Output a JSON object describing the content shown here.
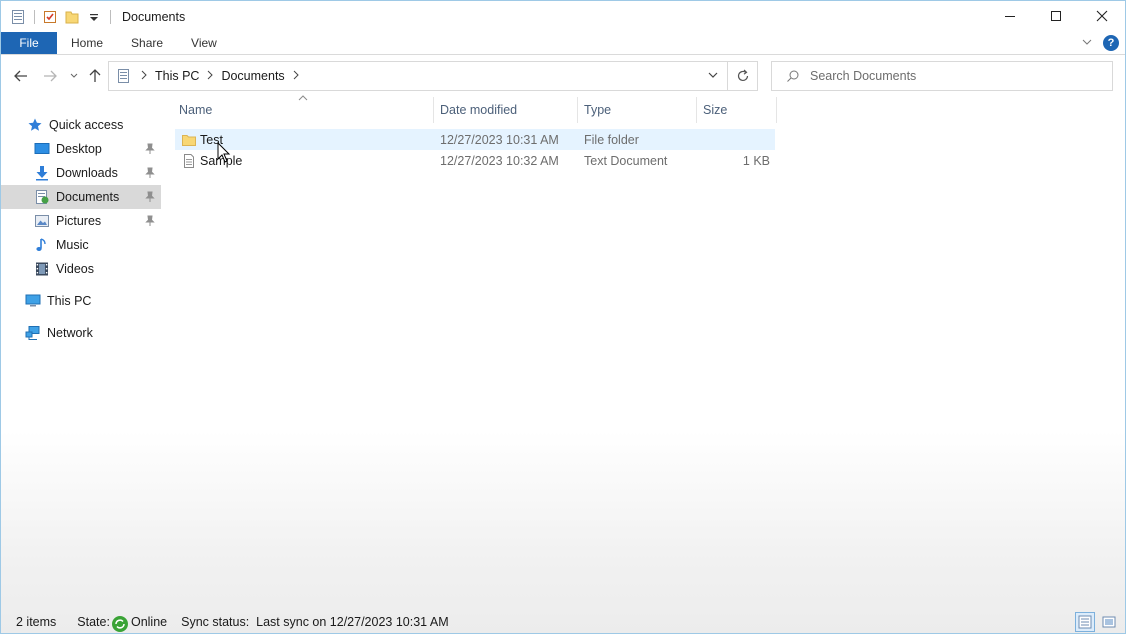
{
  "window": {
    "title": "Documents",
    "controls": {
      "minimize": "—",
      "maximize": "☐",
      "close": "✕"
    }
  },
  "ribbon": {
    "tabs": [
      "File",
      "Home",
      "Share",
      "View"
    ],
    "help": "?"
  },
  "nav": {
    "breadcrumb": [
      "This PC",
      "Documents"
    ],
    "search_placeholder": "Search Documents"
  },
  "sidebar": {
    "items": [
      {
        "label": "Quick access",
        "icon": "star-icon",
        "pinned": false,
        "selected": false
      },
      {
        "label": "Desktop",
        "icon": "desktop-folder-icon",
        "pinned": true,
        "selected": false
      },
      {
        "label": "Downloads",
        "icon": "download-arrow-icon",
        "pinned": true,
        "selected": false
      },
      {
        "label": "Documents",
        "icon": "documents-folder-icon",
        "pinned": true,
        "selected": true
      },
      {
        "label": "Pictures",
        "icon": "pictures-folder-icon",
        "pinned": true,
        "selected": false
      },
      {
        "label": "Music",
        "icon": "music-note-icon",
        "pinned": false,
        "selected": false
      },
      {
        "label": "Videos",
        "icon": "film-icon",
        "pinned": false,
        "selected": false
      },
      {
        "label": "This PC",
        "icon": "computer-icon",
        "pinned": false,
        "selected": false
      },
      {
        "label": "Network",
        "icon": "network-icon",
        "pinned": false,
        "selected": false
      }
    ]
  },
  "columns": [
    "Name",
    "Date modified",
    "Type",
    "Size"
  ],
  "files": [
    {
      "name": "Test",
      "date": "12/27/2023 10:31 AM",
      "type": "File folder",
      "size": "",
      "icon": "folder-icon"
    },
    {
      "name": "Sample",
      "date": "12/27/2023 10:32 AM",
      "type": "Text Document",
      "size": "1 KB",
      "icon": "text-file-icon"
    }
  ],
  "status": {
    "count": "2 items",
    "state_label": "State:",
    "state_value": "Online",
    "sync": "Sync status:  Last sync on 12/27/2023 10:31 AM"
  },
  "colors": {
    "accent": "#1e66b4",
    "selection": "#d9d9d9",
    "hover": "#e5f3ff",
    "online": "#3aa336"
  }
}
